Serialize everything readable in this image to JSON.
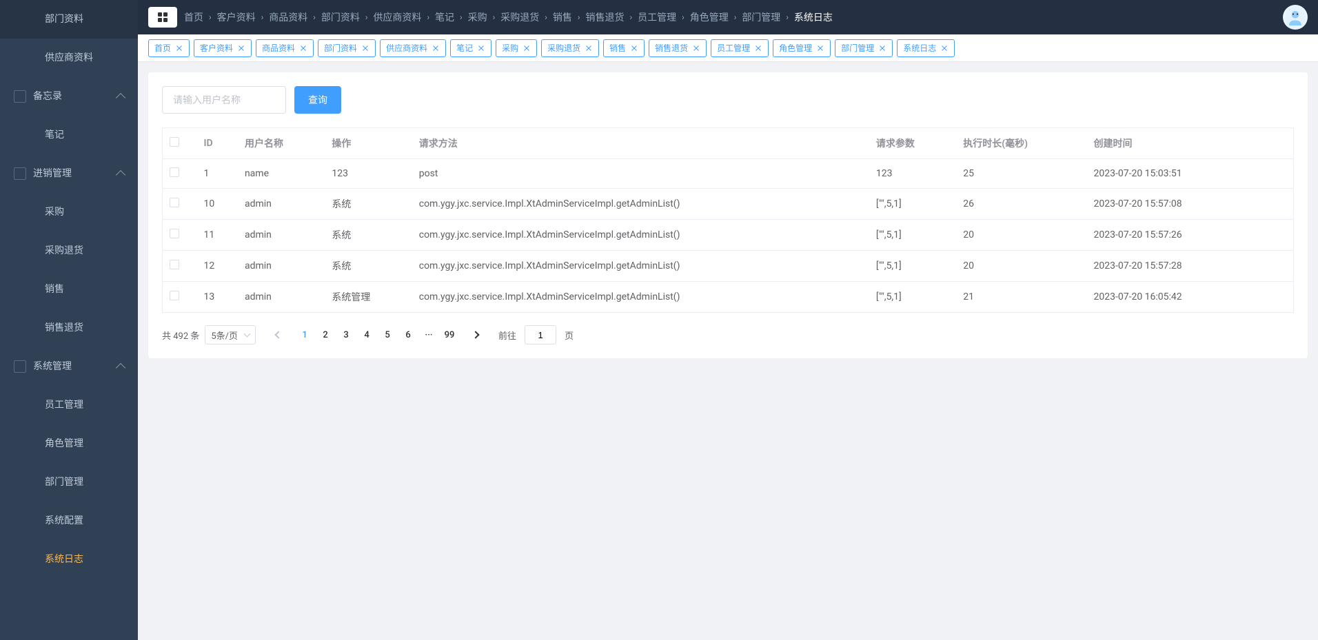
{
  "sidebar": {
    "items": [
      {
        "label": "部门资料",
        "type": "item"
      },
      {
        "label": "供应商资料",
        "type": "item"
      },
      {
        "label": "备忘录",
        "type": "group"
      },
      {
        "label": "笔记",
        "type": "item"
      },
      {
        "label": "进销管理",
        "type": "group"
      },
      {
        "label": "采购",
        "type": "item"
      },
      {
        "label": "采购退货",
        "type": "item"
      },
      {
        "label": "销售",
        "type": "item"
      },
      {
        "label": "销售退货",
        "type": "item"
      },
      {
        "label": "系统管理",
        "type": "group"
      },
      {
        "label": "员工管理",
        "type": "item"
      },
      {
        "label": "角色管理",
        "type": "item"
      },
      {
        "label": "部门管理",
        "type": "item"
      },
      {
        "label": "系统配置",
        "type": "item"
      },
      {
        "label": "系统日志",
        "type": "item",
        "active": true
      }
    ]
  },
  "breadcrumb": {
    "items": [
      "首页",
      "客户资料",
      "商品资料",
      "部门资料",
      "供应商资料",
      "笔记",
      "采购",
      "采购退货",
      "销售",
      "销售退货",
      "员工管理",
      "角色管理",
      "部门管理",
      "系统日志"
    ]
  },
  "tabs": {
    "items": [
      {
        "label": "首页"
      },
      {
        "label": "客户资料"
      },
      {
        "label": "商品资料"
      },
      {
        "label": "部门资料"
      },
      {
        "label": "供应商资料"
      },
      {
        "label": "笔记"
      },
      {
        "label": "采购"
      },
      {
        "label": "采购退货"
      },
      {
        "label": "销售"
      },
      {
        "label": "销售退货"
      },
      {
        "label": "员工管理"
      },
      {
        "label": "角色管理"
      },
      {
        "label": "部门管理"
      },
      {
        "label": "系统日志"
      }
    ]
  },
  "search": {
    "placeholder": "请输入用户名称",
    "button": "查询"
  },
  "table": {
    "headers": [
      "ID",
      "用户名称",
      "操作",
      "请求方法",
      "请求参数",
      "执行时长(毫秒)",
      "创建时间"
    ],
    "rows": [
      {
        "id": "1",
        "username": "name",
        "operation": "123",
        "method": "post",
        "params": "123",
        "duration": "25",
        "created": "2023-07-20 15:03:51"
      },
      {
        "id": "10",
        "username": "admin",
        "operation": "系统",
        "method": "com.ygy.jxc.service.Impl.XtAdminServiceImpl.getAdminList()",
        "params": "[\"\",5,1]",
        "duration": "26",
        "created": "2023-07-20 15:57:08"
      },
      {
        "id": "11",
        "username": "admin",
        "operation": "系统",
        "method": "com.ygy.jxc.service.Impl.XtAdminServiceImpl.getAdminList()",
        "params": "[\"\",5,1]",
        "duration": "20",
        "created": "2023-07-20 15:57:26"
      },
      {
        "id": "12",
        "username": "admin",
        "operation": "系统",
        "method": "com.ygy.jxc.service.Impl.XtAdminServiceImpl.getAdminList()",
        "params": "[\"\",5,1]",
        "duration": "20",
        "created": "2023-07-20 15:57:28"
      },
      {
        "id": "13",
        "username": "admin",
        "operation": "系统管理",
        "method": "com.ygy.jxc.service.Impl.XtAdminServiceImpl.getAdminList()",
        "params": "[\"\",5,1]",
        "duration": "21",
        "created": "2023-07-20 16:05:42"
      }
    ]
  },
  "pagination": {
    "total_text": "共 492 条",
    "page_size": "5条/页",
    "pages": [
      "1",
      "2",
      "3",
      "4",
      "5",
      "6",
      "···",
      "99"
    ],
    "goto_prefix": "前往",
    "goto_value": "1",
    "goto_suffix": "页"
  }
}
